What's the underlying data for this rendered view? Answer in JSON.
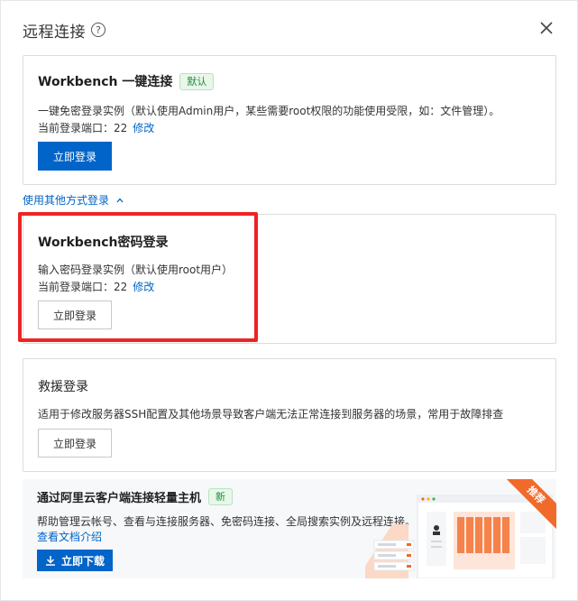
{
  "dialog": {
    "title": "远程连接",
    "help_icon": "question-circle-icon",
    "close_icon": "close-icon"
  },
  "workbench": {
    "title": "Workbench 一键连接",
    "badge": "默认",
    "desc": "一键免密登录实例（默认使用Admin用户，某些需要root权限的功能使用受限，如：文件管理）。",
    "port_label": "当前登录端口：22",
    "modify": "修改",
    "login_button": "立即登录"
  },
  "other_methods": {
    "label": "使用其他方式登录",
    "chevron_icon": "chevron-up-icon"
  },
  "password_login": {
    "title": "Workbench密码登录",
    "desc": "输入密码登录实例（默认使用root用户）",
    "port_label": "当前登录端口：22",
    "modify": "修改",
    "login_button": "立即登录"
  },
  "rescue_login": {
    "title": "救援登录",
    "desc": "适用于修改服务器SSH配置及其他场景导致客户端无法正常连接到服务器的场景，常用于故障排查",
    "login_button": "立即登录"
  },
  "promo": {
    "title": "通过阿里云客户端连接轻量主机",
    "badge": "新",
    "desc": "帮助管理云帐号、查看与连接服务器、免密码连接、全局搜索实例及远程连接。",
    "doc_link": "查看文档介绍",
    "download_button": "立即下载",
    "download_icon": "download-icon",
    "ribbon": "推荐"
  },
  "colors": {
    "primary": "#0064c8",
    "highlight": "#ee2323",
    "badge_green": "#1e8e3e",
    "ribbon_orange": "#f06a2c"
  }
}
